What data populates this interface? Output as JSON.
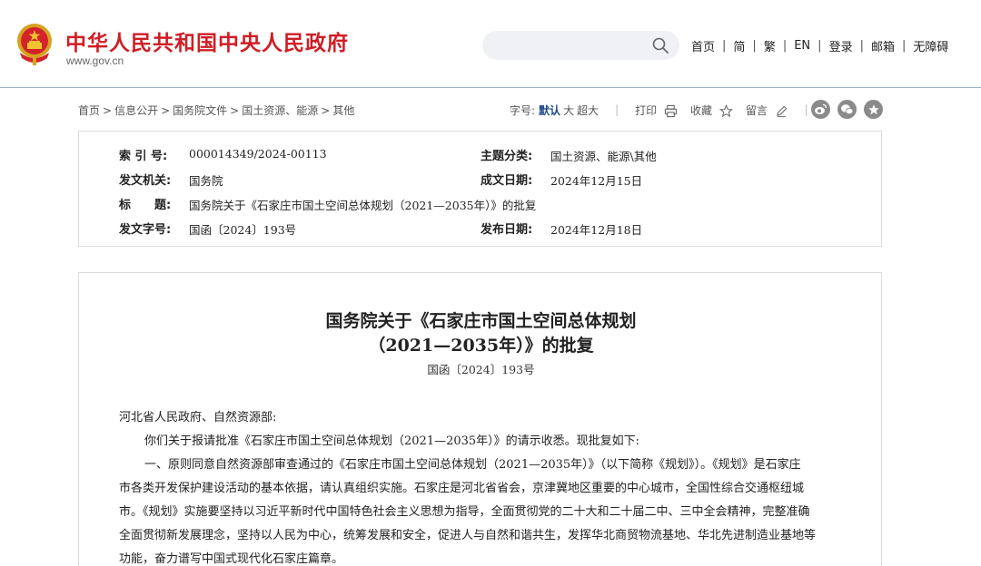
{
  "header": {
    "site_title": "中华人民共和国中央人民政府",
    "site_domain": "www.gov.cn",
    "search_placeholder": "",
    "nav": [
      "首页",
      "简",
      "繁",
      "EN",
      "登录",
      "邮箱",
      "无障碍"
    ]
  },
  "colors": {
    "brand_red": "#cf1e25",
    "accent_blue": "#1e4a8e",
    "border": "#dcdcdc"
  },
  "breadcrumb": [
    "首页",
    "信息公开",
    "国务院文件",
    "国土资源、能源",
    "其他"
  ],
  "toolbar": {
    "font_size_label": "字号:",
    "font_default": "默认",
    "font_large": "大",
    "font_xlarge": "超大",
    "print_label": "打印",
    "favorite_label": "收藏",
    "comment_label": "留言"
  },
  "share_icons": [
    "weibo-icon",
    "wechat-icon",
    "star-circle-icon"
  ],
  "info": {
    "index_label": "索 引 号:",
    "index_value": "000014349/2024-00113",
    "category_label": "主题分类:",
    "category_value": "国土资源、能源\\其他",
    "issuer_label": "发文机关:",
    "issuer_value": "国务院",
    "created_label": "成文日期:",
    "created_value": "2024年12月15日",
    "title_label": "标　　题:",
    "title_value": "国务院关于《石家庄市国土空间总体规划（2021—2035年）》的批复",
    "docno_label": "发文字号:",
    "docno_value": "国函〔2024〕193号",
    "published_label": "发布日期:",
    "published_value": "2024年12月18日"
  },
  "article": {
    "title_line1": "国务院关于《石家庄市国土空间总体规划",
    "title_line2": "（2021—2035年）》的批复",
    "doc_number": "国函〔2024〕193号",
    "salutation": "河北省人民政府、自然资源部:",
    "paragraphs": [
      "你们关于报请批准《石家庄市国土空间总体规划（2021—2035年）》的请示收悉。现批复如下:",
      "一、原则同意自然资源部审查通过的《石家庄市国土空间总体规划（2021—2035年）》（以下简称《规划》）。《规划》是石家庄",
      "市各类开发保护建设活动的基本依据，请认真组织实施。石家庄是河北省省会，京津冀地区重要的中心城市，全国性综合交通枢纽城",
      "市。《规划》实施要坚持以习近平新时代中国特色社会主义思想为指导，全面贯彻党的二十大和二十届二中、三中全会精神，完整准确",
      "全面贯彻新发展理念，坚持以人民为中心，统筹发展和安全，促进人与自然和谐共生，发挥华北商贸物流基地、华北先进制造业基地等",
      "功能，奋力谱写中国式现代化石家庄篇章。"
    ]
  }
}
